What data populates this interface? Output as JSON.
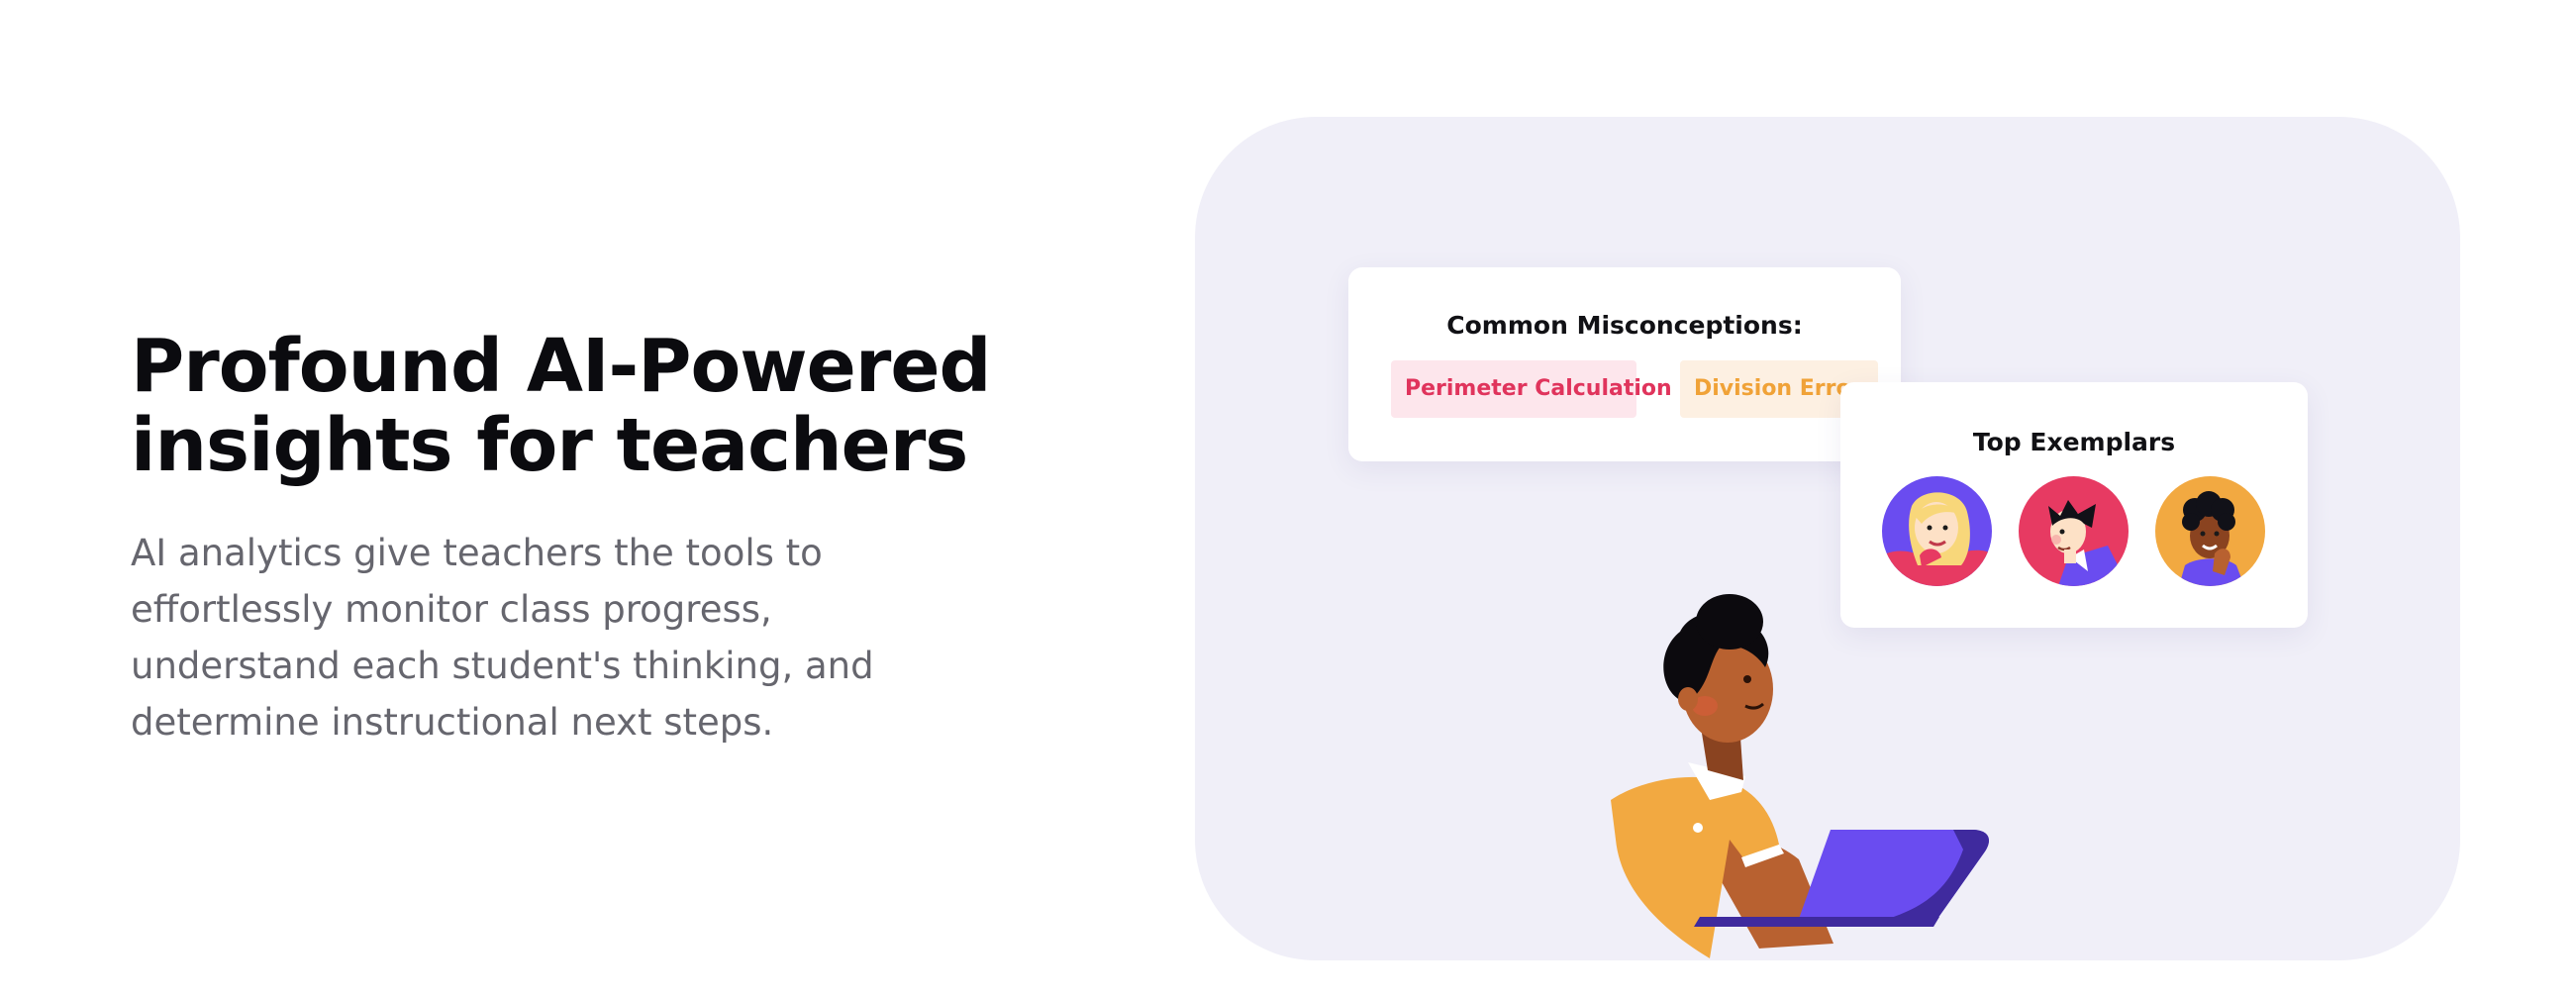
{
  "hero": {
    "title_line1": "Profound AI-Powered",
    "title_line2": "insights for teachers",
    "body_lines": [
      "AI analytics give teachers the tools to",
      "effortlessly monitor class progress,",
      "understand each student's thinking, and",
      "determine instructional next steps."
    ]
  },
  "misconceptions_card": {
    "title": "Common Misconceptions:",
    "tags": [
      "Perimeter Calculation",
      "Division Error"
    ]
  },
  "exemplars_card": {
    "title": "Top Exemplars",
    "avatars": [
      "student-avatar-blonde",
      "student-avatar-dark-hair",
      "student-avatar-curly-hair"
    ]
  },
  "colors": {
    "panel_background": "#f0eff8",
    "red_tag_background": "#fde6ec",
    "red_tag_text": "#e0345c",
    "orange_tag_background": "#fdf0e2",
    "orange_tag_text": "#f0a237",
    "laptop": "#6a4cf0",
    "shirt": "#f2a941"
  }
}
